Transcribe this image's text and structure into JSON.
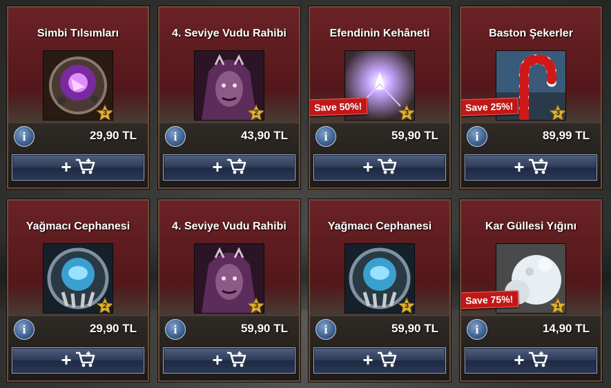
{
  "currency_note": "TL",
  "cards": [
    {
      "title": "Simbi Tılsımları",
      "price": "29,90 TL",
      "level": "3",
      "save": "",
      "art": "talisman"
    },
    {
      "title": "4. Seviye Vudu Rahibi",
      "price": "43,90 TL",
      "level": "2",
      "save": "",
      "art": "priest"
    },
    {
      "title": "Efendinin Kehâneti",
      "price": "59,90 TL",
      "level": "3",
      "save": "Save 50%!",
      "art": "prophecy"
    },
    {
      "title": "Baston Şekerler",
      "price": "89,99 TL",
      "level": "3",
      "save": "Save 25%!",
      "art": "candycane"
    },
    {
      "title": "Yağmacı Cephanesi",
      "price": "29,90 TL",
      "level": "2",
      "save": "",
      "art": "armory"
    },
    {
      "title": "4. Seviye Vudu Rahibi",
      "price": "59,90 TL",
      "level": "3",
      "save": "",
      "art": "priest"
    },
    {
      "title": "Yağmacı Cephanesi",
      "price": "59,90 TL",
      "level": "3",
      "save": "",
      "art": "armory"
    },
    {
      "title": "Kar Güllesi Yığını",
      "price": "14,90 TL",
      "level": "1",
      "save": "Save 75%!",
      "art": "snowball"
    }
  ],
  "buttons": {
    "info_symbol": "i",
    "add_symbol": "+"
  },
  "colors": {
    "card_header": "#6b2226",
    "button": "#2e3c58",
    "save_badge": "#c01818",
    "level_star": "#e0b030"
  }
}
